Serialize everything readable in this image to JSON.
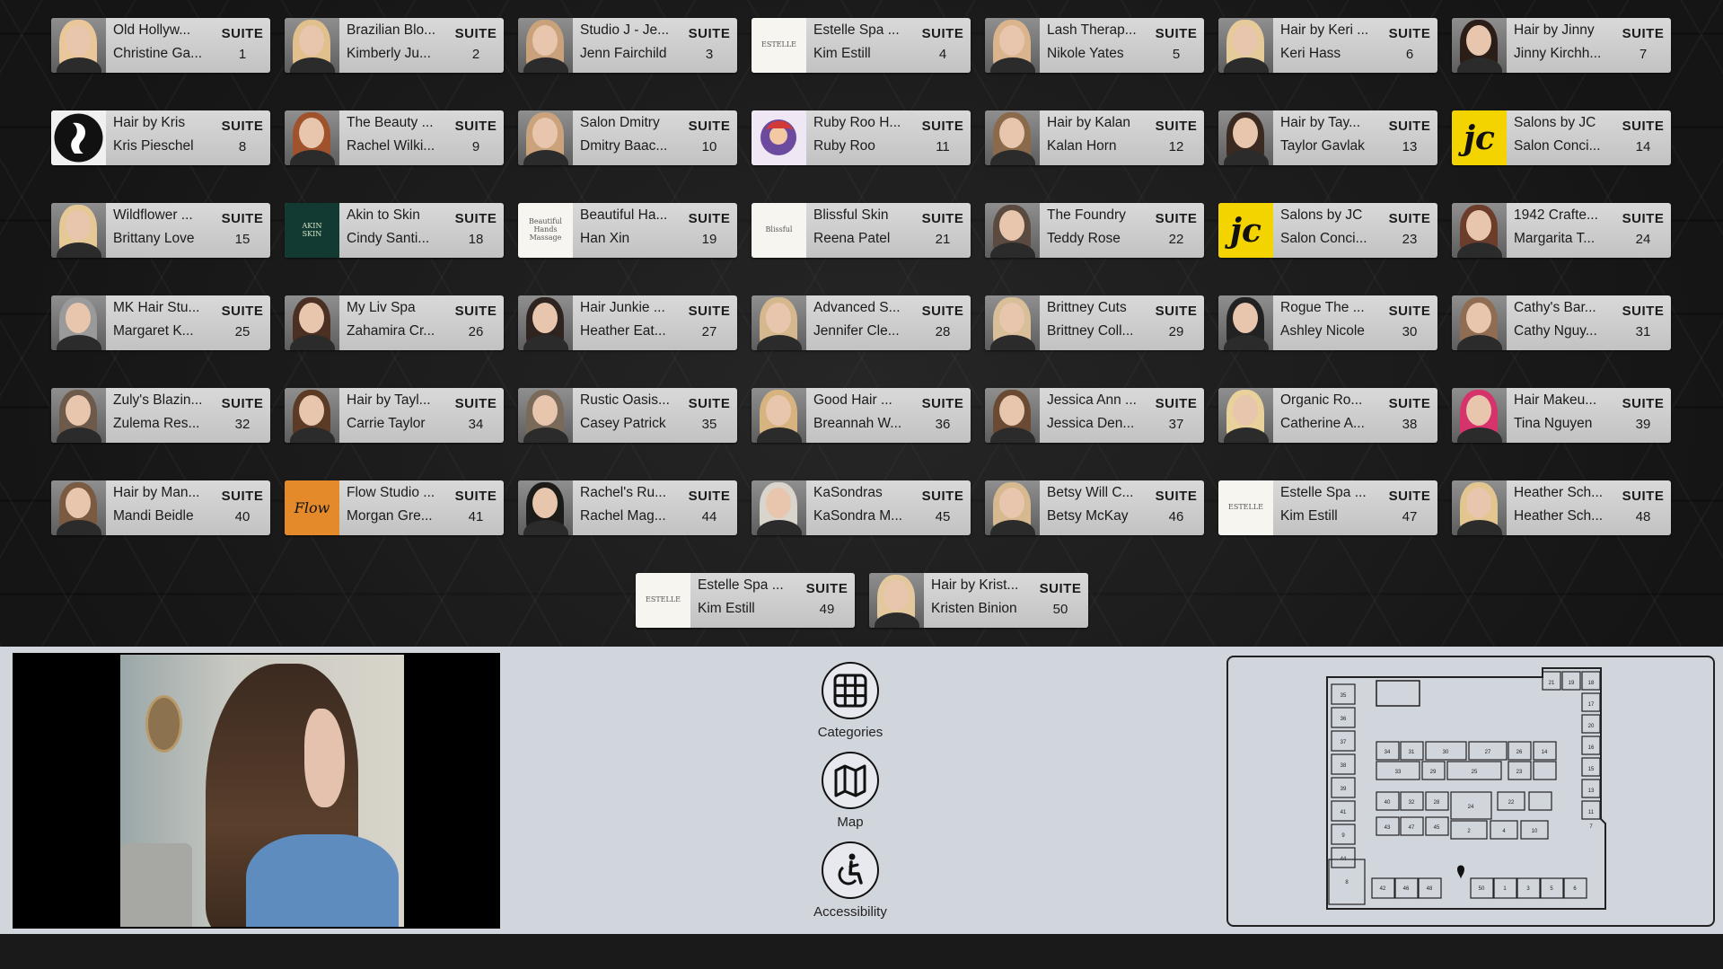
{
  "suites": [
    {
      "business": "Old Hollyw...",
      "owner": "Christine Ga...",
      "suite": "1",
      "thumb": "photo",
      "tone": "#e9c79a"
    },
    {
      "business": "Brazilian Blo...",
      "owner": "Kimberly Ju...",
      "suite": "2",
      "thumb": "photo",
      "tone": "#e2c08e"
    },
    {
      "business": "Studio J - Je...",
      "owner": "Jenn Fairchild",
      "suite": "3",
      "thumb": "photo",
      "tone": "#c9a27b"
    },
    {
      "business": "Estelle Spa ...",
      "owner": "Kim Estill",
      "suite": "4",
      "thumb": "logo-estelle"
    },
    {
      "business": "Lash Therap...",
      "owner": "Nikole Yates",
      "suite": "5",
      "thumb": "photo",
      "tone": "#d9b48c"
    },
    {
      "business": "Hair by Keri ...",
      "owner": "Keri Hass",
      "suite": "6",
      "thumb": "photo",
      "tone": "#e6cb9a"
    },
    {
      "business": "Hair by Jinny",
      "owner": "Jinny Kirchh...",
      "suite": "7",
      "thumb": "photo",
      "tone": "#2b1d18"
    },
    {
      "business": "Hair by Kris",
      "owner": "Kris Pieschel",
      "suite": "8",
      "thumb": "logo-kris"
    },
    {
      "business": "The Beauty ...",
      "owner": "Rachel Wilki...",
      "suite": "9",
      "thumb": "photo",
      "tone": "#a0522d"
    },
    {
      "business": "Salon Dmitry",
      "owner": "Dmitry Baac...",
      "suite": "10",
      "thumb": "photo",
      "tone": "#caa37c"
    },
    {
      "business": "Ruby Roo H...",
      "owner": "Ruby Roo",
      "suite": "11",
      "thumb": "logo-ruby"
    },
    {
      "business": "Hair by Kalan",
      "owner": "Kalan Horn",
      "suite": "12",
      "thumb": "photo",
      "tone": "#8a6a4b"
    },
    {
      "business": "Hair by Tay...",
      "owner": "Taylor Gavlak",
      "suite": "13",
      "thumb": "photo",
      "tone": "#3a2a22"
    },
    {
      "business": "Salons by JC",
      "owner": "Salon Conci...",
      "suite": "14",
      "thumb": "logo-jc"
    },
    {
      "business": "Wildflower ...",
      "owner": "Brittany Love",
      "suite": "15",
      "thumb": "photo",
      "tone": "#e4c896"
    },
    {
      "business": "Akin to Skin",
      "owner": "Cindy Santi...",
      "suite": "18",
      "thumb": "logo-akin"
    },
    {
      "business": "Beautiful Ha...",
      "owner": "Han Xin",
      "suite": "19",
      "thumb": "logo-massage"
    },
    {
      "business": "Blissful Skin",
      "owner": "Reena Patel",
      "suite": "21",
      "thumb": "logo-blissful"
    },
    {
      "business": "The Foundry",
      "owner": "Teddy Rose",
      "suite": "22",
      "thumb": "photo",
      "tone": "#5a4a40"
    },
    {
      "business": "Salons by JC",
      "owner": "Salon Conci...",
      "suite": "23",
      "thumb": "logo-jc"
    },
    {
      "business": "1942 Crafte...",
      "owner": "Margarita T...",
      "suite": "24",
      "thumb": "photo",
      "tone": "#6b3d2a"
    },
    {
      "business": "MK Hair Stu...",
      "owner": "Margaret K...",
      "suite": "25",
      "thumb": "photo",
      "tone": "#9a9a9a"
    },
    {
      "business": "My Liv Spa",
      "owner": "Zahamira Cr...",
      "suite": "26",
      "thumb": "photo",
      "tone": "#4a2f22"
    },
    {
      "business": "Hair Junkie ...",
      "owner": "Heather Eat...",
      "suite": "27",
      "thumb": "photo",
      "tone": "#2f2420"
    },
    {
      "business": "Advanced S...",
      "owner": "Jennifer Cle...",
      "suite": "28",
      "thumb": "photo",
      "tone": "#d6b88e"
    },
    {
      "business": "Brittney Cuts",
      "owner": "Brittney Coll...",
      "suite": "29",
      "thumb": "photo",
      "tone": "#d8bf9a"
    },
    {
      "business": "Rogue The ...",
      "owner": "Ashley Nicole",
      "suite": "30",
      "thumb": "photo",
      "tone": "#222222"
    },
    {
      "business": "Cathy's Bar...",
      "owner": "Cathy Nguy...",
      "suite": "31",
      "thumb": "photo",
      "tone": "#8f6c52"
    },
    {
      "business": "Zuly's Blazin...",
      "owner": "Zulema Res...",
      "suite": "32",
      "thumb": "photo",
      "tone": "#6d5a4a"
    },
    {
      "business": "Hair by Tayl...",
      "owner": "Carrie Taylor",
      "suite": "34",
      "thumb": "photo",
      "tone": "#5b3a26"
    },
    {
      "business": "Rustic Oasis...",
      "owner": "Casey Patrick",
      "suite": "35",
      "thumb": "photo",
      "tone": "#7a6a5a"
    },
    {
      "business": "Good Hair ...",
      "owner": "Breannah W...",
      "suite": "36",
      "thumb": "photo",
      "tone": "#d7b47f"
    },
    {
      "business": "Jessica Ann ...",
      "owner": "Jessica Den...",
      "suite": "37",
      "thumb": "photo",
      "tone": "#6a4a33"
    },
    {
      "business": "Organic Ro...",
      "owner": "Catherine A...",
      "suite": "38",
      "thumb": "photo",
      "tone": "#e8d19a"
    },
    {
      "business": "Hair Makeu...",
      "owner": "Tina Nguyen",
      "suite": "39",
      "thumb": "photo",
      "tone": "#d6336c"
    },
    {
      "business": "Hair by Man...",
      "owner": "Mandi Beidle",
      "suite": "40",
      "thumb": "photo",
      "tone": "#7a5a40"
    },
    {
      "business": "Flow Studio ...",
      "owner": "Morgan Gre...",
      "suite": "41",
      "thumb": "logo-flow"
    },
    {
      "business": "Rachel's Ru...",
      "owner": "Rachel Mag...",
      "suite": "44",
      "thumb": "photo",
      "tone": "#1d1a1a"
    },
    {
      "business": "KaSondras",
      "owner": "KaSondra M...",
      "suite": "45",
      "thumb": "photo",
      "tone": "#d9d4cc"
    },
    {
      "business": "Betsy Will C...",
      "owner": "Betsy McKay",
      "suite": "46",
      "thumb": "photo",
      "tone": "#d7b98f"
    },
    {
      "business": "Estelle Spa ...",
      "owner": "Kim Estill",
      "suite": "47",
      "thumb": "logo-estelle"
    },
    {
      "business": "Heather Sch...",
      "owner": "Heather Sch...",
      "suite": "48",
      "thumb": "photo",
      "tone": "#e3c68f"
    },
    {
      "business": "Estelle Spa ...",
      "owner": "Kim Estill",
      "suite": "49",
      "thumb": "logo-estelle"
    },
    {
      "business": "Hair by Krist...",
      "owner": "Kristen Binion",
      "suite": "50",
      "thumb": "photo",
      "tone": "#e2c89c"
    }
  ],
  "suite_label": "SUITE",
  "nav": [
    {
      "label": "Categories",
      "icon": "grid-icon"
    },
    {
      "label": "Map",
      "icon": "map-icon"
    },
    {
      "label": "Accessibility",
      "icon": "accessibility-icon"
    }
  ],
  "logos": {
    "jc": "jc",
    "estelle": "ESTELLE",
    "akin": "AKIN\nSKIN",
    "massage": "Beautiful Hands\nMassage",
    "blissful": "Blissful",
    "flow": "Flow"
  },
  "floorplan_labels": [
    "21",
    "19",
    "18",
    "17",
    "20",
    "16",
    "35",
    "36",
    "15",
    "37",
    "34",
    "31",
    "30",
    "27",
    "26",
    "14",
    "33",
    "29",
    "25",
    "23",
    "13",
    "38",
    "39",
    "40",
    "32",
    "28",
    "24",
    "22",
    "11",
    "41",
    "43",
    "47",
    "45",
    "2",
    "4",
    "10",
    "9",
    "42",
    "46",
    "48",
    "50",
    "1",
    "3",
    "5",
    "6",
    "8",
    "44",
    "7",
    "12"
  ]
}
